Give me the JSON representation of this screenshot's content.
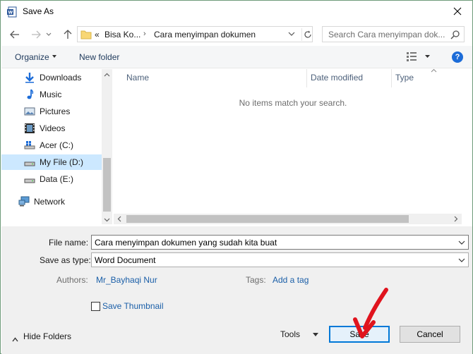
{
  "window": {
    "title": "Save As"
  },
  "address": {
    "overflow": "«",
    "crumb1": "Bisa Ko...",
    "crumb2": "Cara menyimpan dokumen"
  },
  "search": {
    "placeholder": "Search Cara menyimpan dok..."
  },
  "toolbar": {
    "organize": "Organize",
    "new_folder": "New folder",
    "help": "?"
  },
  "nav": {
    "items": [
      {
        "label": "Downloads",
        "icon": "download-arrow-icon"
      },
      {
        "label": "Music",
        "icon": "music-note-icon"
      },
      {
        "label": "Pictures",
        "icon": "pictures-icon"
      },
      {
        "label": "Videos",
        "icon": "film-icon"
      },
      {
        "label": "Acer (C:)",
        "icon": "drive-icon"
      },
      {
        "label": "My File (D:)",
        "icon": "drive-icon",
        "selected": true
      },
      {
        "label": "Data (E:)",
        "icon": "drive-icon"
      },
      {
        "label": "Network",
        "icon": "network-icon"
      }
    ]
  },
  "filelist": {
    "columns": [
      "Name",
      "Date modified",
      "Type"
    ],
    "empty_message": "No items match your search."
  },
  "form": {
    "file_name_label": "File name:",
    "file_name_value": "Cara menyimpan dokumen yang sudah kita buat",
    "save_type_label": "Save as type:",
    "save_type_value": "Word Document",
    "authors_label": "Authors:",
    "authors_value": "Mr_Bayhaqi Nur",
    "tags_label": "Tags:",
    "tags_value": "Add a tag",
    "thumbnail_label": "Save Thumbnail"
  },
  "footer": {
    "hide_folders": "Hide Folders",
    "tools": "Tools",
    "save": "Save",
    "cancel": "Cancel"
  },
  "colors": {
    "accent": "#0078d7",
    "link": "#1b5fa8",
    "selection": "#cce8ff",
    "annotation_arrow": "#e0141e"
  }
}
